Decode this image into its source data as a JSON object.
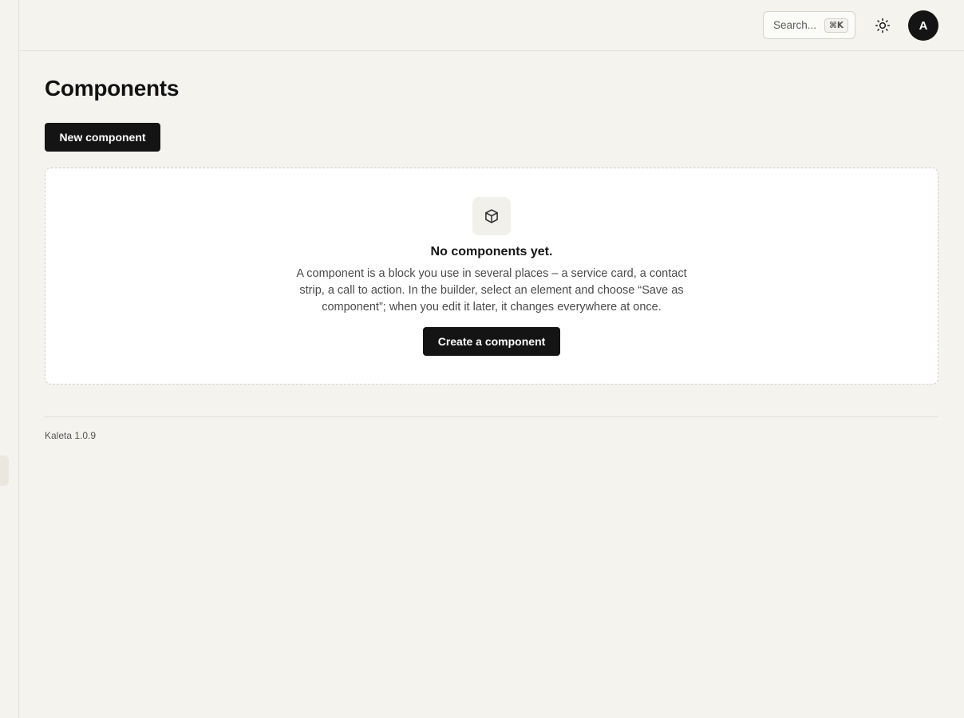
{
  "header": {
    "search": {
      "placeholder": "Search...",
      "shortcut": "⌘K"
    },
    "theme_icon": "sun-icon",
    "avatar_initial": "A"
  },
  "page": {
    "title": "Components",
    "new_button_label": "New component"
  },
  "empty_state": {
    "icon": "package-icon",
    "title": "No components yet.",
    "description": "A component is a block you use in several places – a service card, a contact strip, a call to action. In the builder, select an element and choose “Save as component”; when you edit it later, it changes everywhere at once.",
    "cta_label": "Create a component"
  },
  "footer": {
    "version": "Kaleta 1.0.9"
  }
}
